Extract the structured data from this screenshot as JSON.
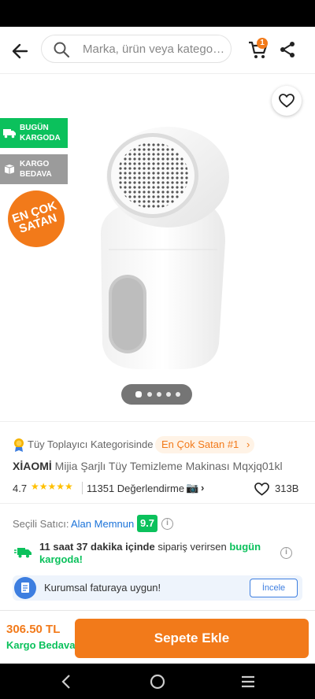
{
  "search": {
    "placeholder": "Marka, ürün veya kategori..."
  },
  "header": {
    "cart_count": "1"
  },
  "gallery": {
    "badges": {
      "kargo_line1": "BUGÜN",
      "kargo_line2": "KARGODA",
      "bedava_line1": "KARGO",
      "bedava_line2": "BEDAVA",
      "encok_line1": "EN ÇOK",
      "encok_line2": "SATAN"
    },
    "page_count": 5,
    "active_page": 1
  },
  "product": {
    "category_text": "Tüy Toplayıcı Kategorisinde",
    "category_rank": "En Çok Satan #1",
    "brand": "XİAOMİ",
    "name": "Mijia Şarjlı Tüy Temizleme Makinası Mqxjq01kl",
    "rating": "4.7",
    "stars": "★★★★★",
    "review_count": "11351 Değerlendirme",
    "likes": "313B"
  },
  "seller": {
    "label": "Seçili Satıcı:",
    "name": "Alan Memnun",
    "score": "9.7"
  },
  "delivery": {
    "time_bold": "11 saat 37 dakika içinde",
    "mid": " sipariş verirsen ",
    "highlight": "bugün kargoda!"
  },
  "corporate": {
    "text": "Kurumsal faturaya uygun!",
    "button": "İncele"
  },
  "bottom": {
    "price": "306.50 TL",
    "shipping": "Kargo Bedava",
    "cta": "Sepete Ekle"
  },
  "colors": {
    "accent": "#f27a1a",
    "green": "#0bc15c",
    "blue": "#1b73d9"
  }
}
